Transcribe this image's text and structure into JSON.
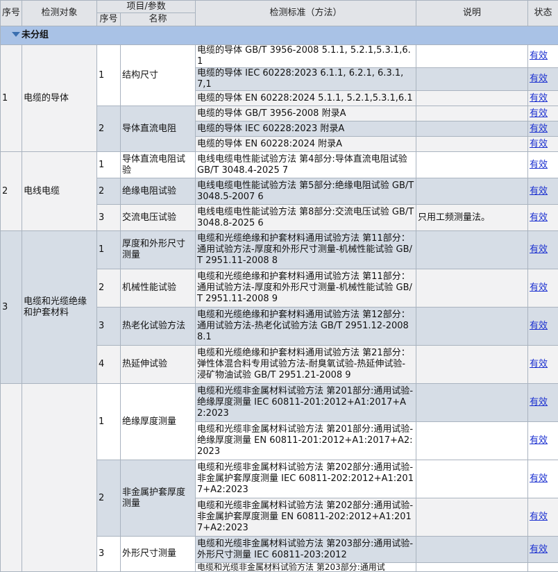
{
  "header": {
    "seq": "序号",
    "object": "检测对象",
    "item_param": "项目/参数",
    "sub_seq": "序号",
    "name": "名称",
    "standard": "检测标准（方法）",
    "note": "说明",
    "status": "状态"
  },
  "group_label": "未分组",
  "status_valid": "有效",
  "colors": {
    "group_bg": "#a9c2e6",
    "link": "#1a2fd0",
    "band_blue": "#d6dde6",
    "band_light": "#f2f2f3"
  },
  "rows": {
    "o1": {
      "seq": "1",
      "object": "电缆的导体",
      "i1": {
        "seq": "1",
        "name": "结构尺寸",
        "s1": "电缆的导体 GB/T 3956-2008 5.1.1, 5.2.1,5.3.1,6.1",
        "s2": "电缆的导体 IEC 60228:2023 6.1.1, 6.2.1, 6.3.1, 7,1",
        "s3": "电缆的导体 EN 60228:2024 5.1.1, 5.2.1,5.3.1,6.1"
      },
      "i2": {
        "seq": "2",
        "name": "导体直流电阻",
        "s1": "电缆的导体 GB/T 3956-2008 附录A",
        "s2": "电缆的导体 IEC 60228:2023 附录A",
        "s3": "电缆的导体 EN 60228:2024 附录A"
      }
    },
    "o2": {
      "seq": "2",
      "object": "电线电缆",
      "i1": {
        "seq": "1",
        "name": "导体直流电阻试验",
        "s1": "电线电缆电性能试验方法 第4部分:导体直流电阻试验 GB/T 3048.4-2025 7"
      },
      "i2": {
        "seq": "2",
        "name": "绝缘电阻试验",
        "s1": "电线电缆电性能试验方法 第5部分:绝缘电阻试验 GB/T 3048.5-2007 6"
      },
      "i3": {
        "seq": "3",
        "name": "交流电压试验",
        "s1": "电线电缆电性能试验方法 第8部分:交流电压试验 GB/T 3048.8-2025 6",
        "note": "只用工频测量法。"
      }
    },
    "o3": {
      "seq": "3",
      "object": "电缆和光缆绝缘和护套材料",
      "i1": {
        "seq": "1",
        "name": "厚度和外形尺寸测量",
        "s1": "电缆和光缆绝缘和护套材料通用试验方法 第11部分：通用试验方法-厚度和外形尺寸测量-机械性能试验 GB/T 2951.11-2008 8"
      },
      "i2": {
        "seq": "2",
        "name": "机械性能试验",
        "s1": "电缆和光缆绝缘和护套材料通用试验方法 第11部分：通用试验方法-厚度和外形尺寸测量-机械性能试验 GB/T 2951.11-2008 9"
      },
      "i3": {
        "seq": "3",
        "name": "热老化试验方法",
        "s1": "电缆和光缆绝缘和护套材料通用试验方法 第12部分：通用试验方法-热老化试验方法 GB/T 2951.12-2008 8.1"
      },
      "i4": {
        "seq": "4",
        "name": "热延伸试验",
        "s1": "电缆和光缆绝缘和护套材料通用试验方法 第21部分：弹性体混合料专用试验方法-耐臭氧试验-热延伸试验-浸矿物油试验 GB/T 2951.21-2008 9"
      }
    },
    "o4": {
      "i1": {
        "seq": "1",
        "name": "绝缘厚度测量",
        "s1": "电缆和光缆非金属材料试验方法 第201部分:通用试验-绝缘厚度测量 IEC 60811-201:2012+A1:2017+A2:2023",
        "s2": "电缆和光缆非金属材料试验方法 第201部分:通用试验-绝缘厚度测量 EN 60811-201:2012+A1:2017+A2:2023"
      },
      "i2": {
        "seq": "2",
        "name": "非金属护套厚度测量",
        "s1": "电缆和光缆非金属材料试验方法 第202部分:通用试验-非金属护套厚度测量 IEC 60811-202:2012+A1:2017+A2:2023",
        "s2": "电缆和光缆非金属材料试验方法 第202部分:通用试验-非金属护套厚度测量 EN 60811-202:2012+A1:2017+A2:2023"
      },
      "i3": {
        "seq": "3",
        "name": "外形尺寸测量",
        "s1": "电缆和光缆非金属材料试验方法 第203部分:通用试验-外形尺寸测量 IEC 60811-203:2012",
        "s2": "电缆和光缆非金属材料试验方法 第203部分:通用试"
      }
    }
  }
}
